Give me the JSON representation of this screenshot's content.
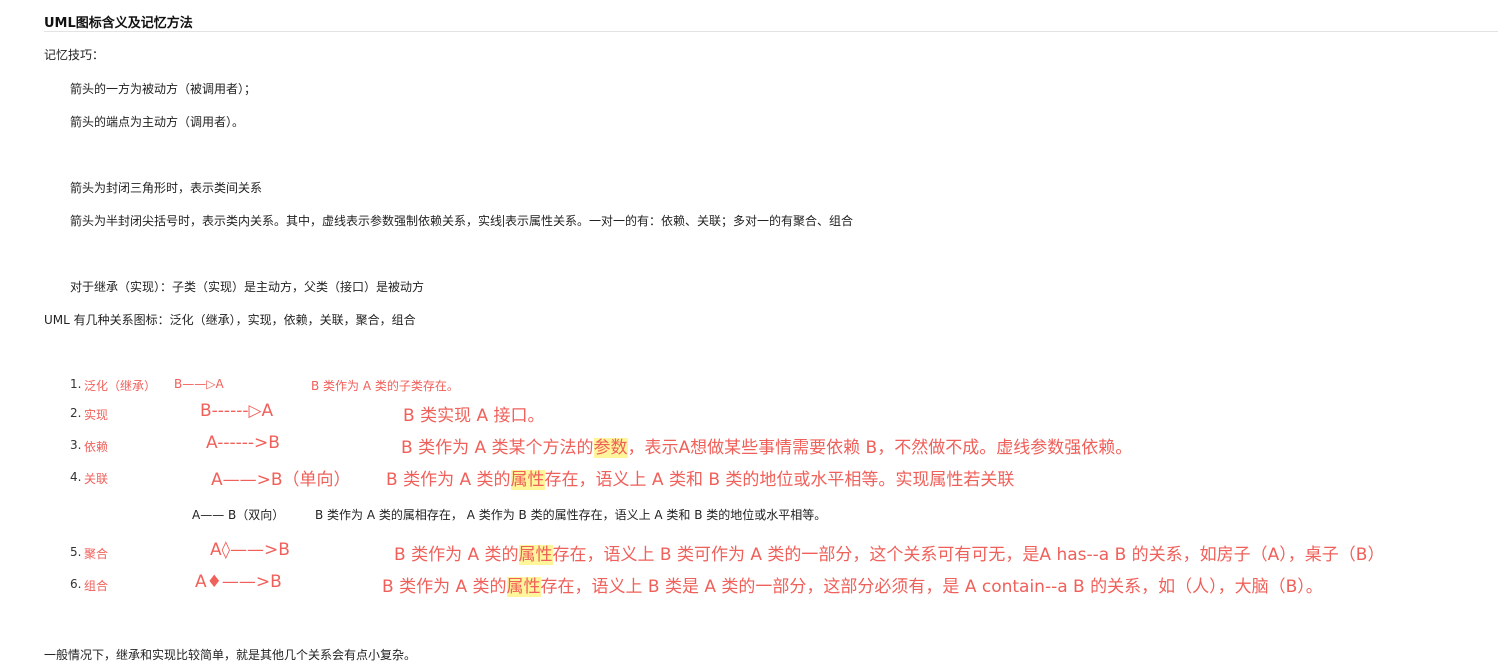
{
  "title": "UML图标含义及记忆方法",
  "tips": {
    "heading": "记忆技巧：",
    "lines": [
      "箭头的一方为被动方（被调用者）；",
      "箭头的端点为主动方（调用者）。",
      "箭头为封闭三角形时，表示类间关系",
      "箭头为半封闭尖括号时，表示类内关系。其中，虚线表示参数强制依赖关系，实线",
      "表示属性关系。一对一的有：依赖、关联；多对一的有聚合、组合",
      "对于继承（实现）：子类（实现）是主动方，父类（接口）是被动方",
      "UML 有几种关系图标：泛化（继承），实现，依赖，关联，聚合，组合"
    ]
  },
  "items": [
    {
      "num": "1.",
      "name": "泛化（继承）",
      "arrow": "B——▷A",
      "desc": "B 类作为 A 类的子类存在。"
    },
    {
      "num": "2.",
      "name": "实现",
      "arrow": "B------▷A",
      "desc": "B 类实现 A 接口。"
    },
    {
      "num": "3.",
      "name": "依赖",
      "arrow": "A------>B",
      "desc_a": "B 类作为 A 类某个方法的",
      "desc_hl": "参数",
      "desc_b": "，表示A想做某些事情需要依赖 B，不然做不成。虚线参数强依赖。"
    },
    {
      "num": "4.",
      "name": "关联",
      "arrow": "A——>B（单向）",
      "desc_a": "B 类作为 A 类的",
      "desc_hl": "属性",
      "desc_b": "存在，语义上 A 类和 B 类的地位或水平相等。实现属性若关联"
    },
    {
      "arrow": "A——  B（双向）",
      "desc": "B 类作为 A 类的属相存在， A 类作为 B 类的属性存在，语义上 A 类和 B 类的地位或水平相等。"
    },
    {
      "num": "5.",
      "name": "聚合",
      "arrow": "A◊——>B",
      "desc_a": "B 类作为 A 类的",
      "desc_hl": "属性",
      "desc_b": "存在，语义上 B 类可作为 A 类的一部分，这个关系可有可无，是A has--a  B 的关系，如房子（A），桌子（B）"
    },
    {
      "num": "6.",
      "name": "组合",
      "arrow": "A♦——>B",
      "desc_a": "B 类作为 A 类的",
      "desc_hl": "属性",
      "desc_b": "存在，语义上 B 类是 A 类的一部分，这部分必须有，是 A contain--a B 的关系，如（人），大脑（B）。"
    }
  ],
  "footer": "一般情况下，继承和实现比较简单，就是其他几个关系会有点小复杂。",
  "colors": {
    "accent_red": "#f0605a",
    "highlight": "#fff59a"
  }
}
